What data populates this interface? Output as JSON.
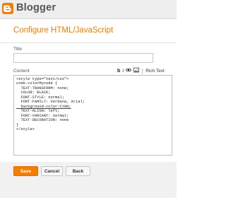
{
  "header": {
    "brand": "Blogger",
    "logo_icon": "blogger-logo-icon",
    "brand_color": "#f57d00"
  },
  "page": {
    "title": "Configure HTML/JavaScript"
  },
  "form": {
    "title_label": "Title",
    "title_value": "",
    "content_label": "Content",
    "toolbar": {
      "bold": "b",
      "italic": "i",
      "rich_text": "Rich Text",
      "icons": [
        "bold-icon",
        "italic-icon",
        "link-icon",
        "image-icon"
      ]
    },
    "code_lines": [
      "<style type=\"text/css\">",
      "code.colorMycode {",
      "  TEXT-TRANSFORM: none;",
      "  COLOR: BLACK;",
      "  FONT-STYLE: normal;",
      "  FONT-FAMILY: Verdana, Arial;",
      "  background-color:CYAN;",
      "  TEXT-ALIGN: left;",
      "  FONT-VARIANT: normal;",
      "  TEXT-DECORATION: none",
      "}",
      "</style>"
    ]
  },
  "actions": {
    "save": "Save",
    "cancel": "Cancel",
    "back": "Back"
  }
}
